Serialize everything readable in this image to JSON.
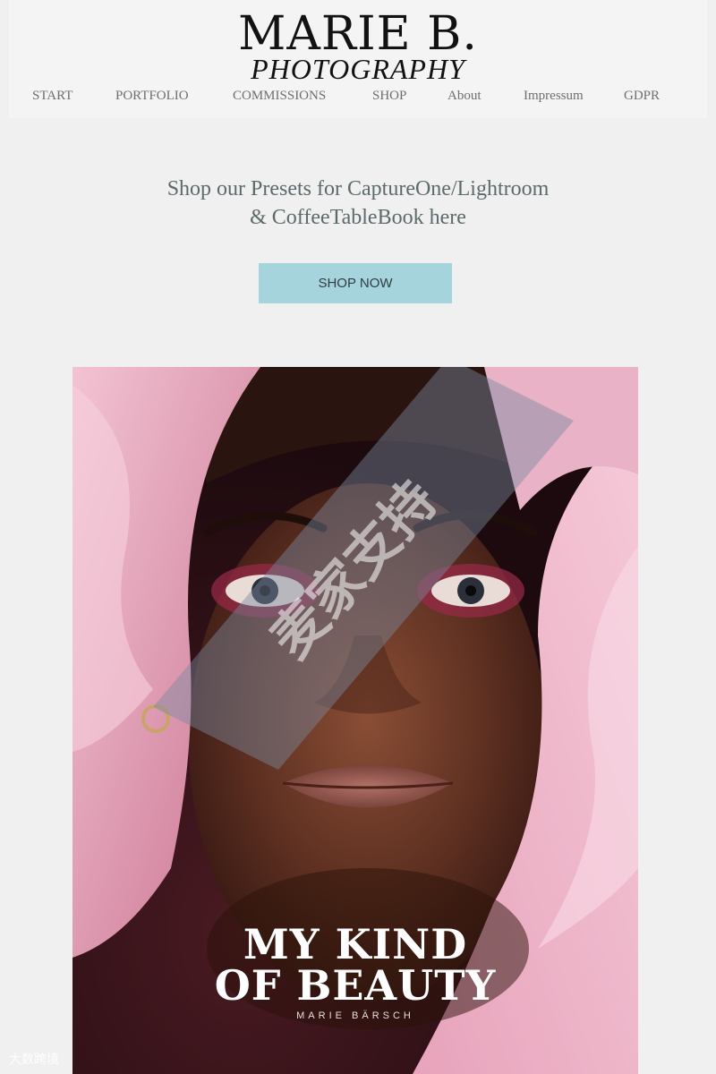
{
  "header": {
    "logo_line1": "MARIE B.",
    "logo_line2": "PHOTOGRAPHY",
    "nav": [
      "START",
      "PORTFOLIO",
      "COMMISSIONS",
      "SHOP",
      "About",
      "Impressum",
      "GDPR"
    ]
  },
  "promo": {
    "line1": "Shop our Presets for CaptureOne/Lightroom",
    "line2": "& CoffeeTableBook here",
    "button_label": "SHOP NOW"
  },
  "cover": {
    "title_line1": "MY KIND",
    "title_line2": "OF BEAUTY",
    "author": "MARIE BÄRSCH"
  },
  "watermark": {
    "center_text": "麦家支持",
    "corner_text": "大数跨境"
  },
  "colors": {
    "background": "#f0f0f0",
    "button": "#a6d4dc",
    "promo_text": "#5d6a6b",
    "nav_text": "#6e6e6e",
    "fur_pink": "#e8a9bf"
  }
}
